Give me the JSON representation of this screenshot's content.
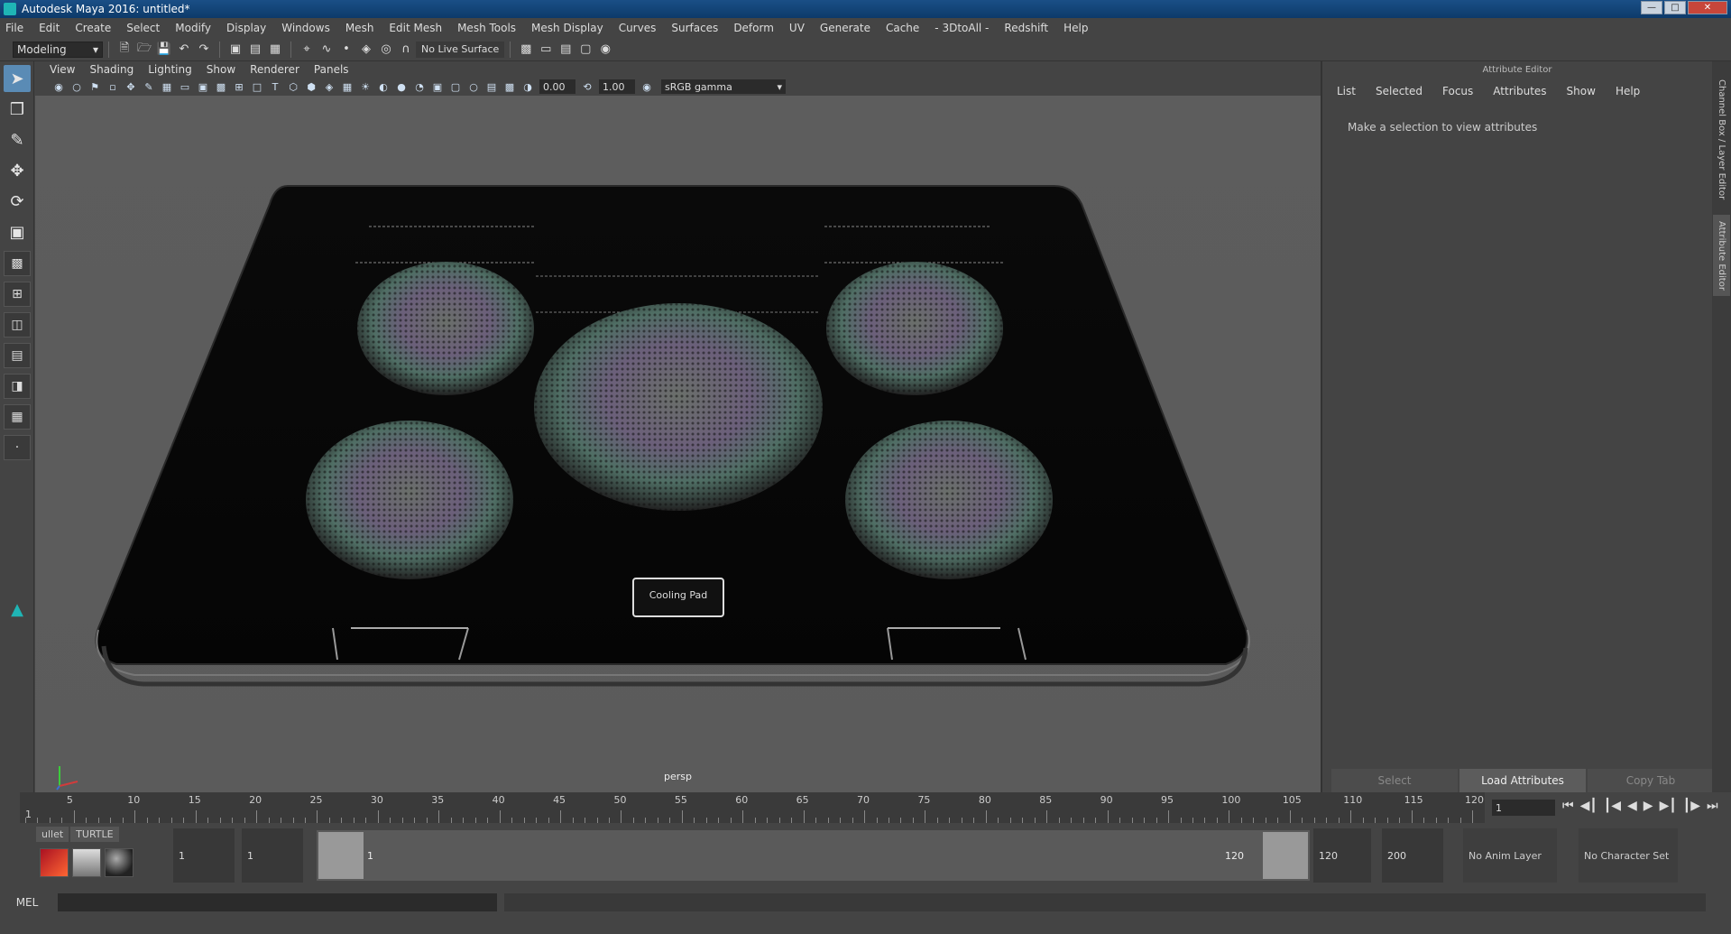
{
  "window": {
    "title": "Autodesk Maya 2016: untitled*"
  },
  "menu": [
    "File",
    "Edit",
    "Create",
    "Select",
    "Modify",
    "Display",
    "Windows",
    "Mesh",
    "Edit Mesh",
    "Mesh Tools",
    "Mesh Display",
    "Curves",
    "Surfaces",
    "Deform",
    "UV",
    "Generate",
    "Cache",
    "- 3DtoAll -",
    "Redshift",
    "Help"
  ],
  "statusline": {
    "mode": "Modeling",
    "live_surface": "No Live Surface"
  },
  "viewport": {
    "menu": [
      "View",
      "Shading",
      "Lighting",
      "Show",
      "Renderer",
      "Panels"
    ],
    "exposure": "0.00",
    "gamma_value": "1.00",
    "color_space": "sRGB gamma",
    "camera_label": "persp",
    "object_label": "Cooling Pad"
  },
  "attribute_editor": {
    "title": "Attribute Editor",
    "menu": [
      "List",
      "Selected",
      "Focus",
      "Attributes",
      "Show",
      "Help"
    ],
    "message": "Make a selection to view attributes",
    "buttons": [
      "Select",
      "Load Attributes",
      "Copy Tab"
    ]
  },
  "side_tabs": {
    "channel_box": "Channel Box / Layer Editor",
    "attribute_editor": "Attribute Editor"
  },
  "timeslider": {
    "ticks": [
      "5",
      "10",
      "15",
      "20",
      "25",
      "30",
      "35",
      "40",
      "45",
      "50",
      "55",
      "60",
      "65",
      "70",
      "75",
      "80",
      "85",
      "90",
      "95",
      "100",
      "105",
      "110",
      "115",
      "120"
    ],
    "start_label": "1",
    "current_frame": "1"
  },
  "range": {
    "start": "1",
    "playback_start": "1",
    "range_start_label": "1",
    "range_end_label": "120",
    "playback_end": "120",
    "end": "200",
    "anim_layer": "No Anim Layer",
    "character_set": "No Character Set"
  },
  "shelf": {
    "tabs": [
      "ullet",
      "TURTLE"
    ]
  },
  "command_line": {
    "label": "MEL"
  }
}
